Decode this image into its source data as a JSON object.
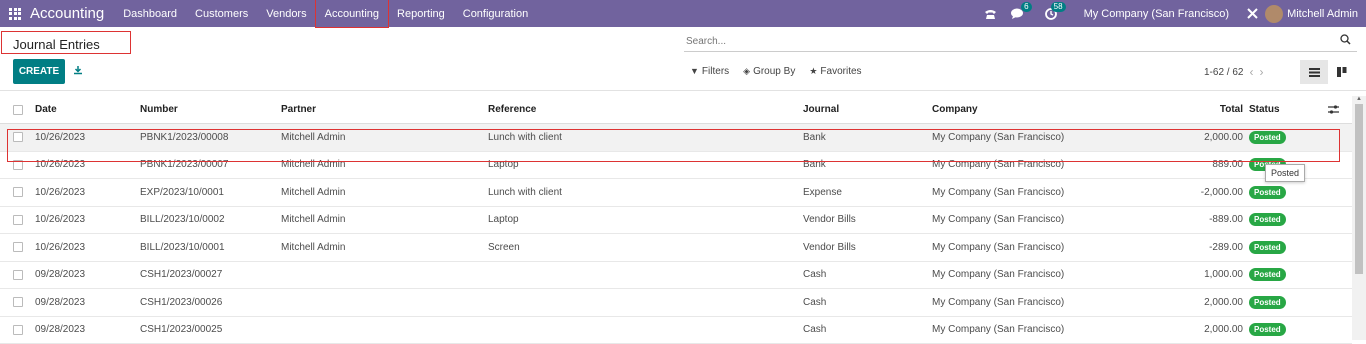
{
  "brand": "Accounting",
  "menu": [
    "Dashboard",
    "Customers",
    "Vendors",
    "Accounting",
    "Reporting",
    "Configuration"
  ],
  "systray": {
    "messages_count": "6",
    "activities_count": "58",
    "company": "My Company (San Francisco)",
    "user": "Mitchell Admin"
  },
  "page_title": "Journal Entries",
  "search": {
    "placeholder": "Search..."
  },
  "create_label": "CREATE",
  "filters": {
    "filters": "Filters",
    "group_by": "Group By",
    "favorites": "Favorites"
  },
  "pager": "1-62 / 62",
  "table": {
    "headers": {
      "date": "Date",
      "number": "Number",
      "partner": "Partner",
      "reference": "Reference",
      "journal": "Journal",
      "company": "Company",
      "total": "Total",
      "status": "Status"
    },
    "rows": [
      {
        "date": "10/26/2023",
        "number": "PBNK1/2023/00008",
        "partner": "Mitchell Admin",
        "reference": "Lunch with client",
        "journal": "Bank",
        "company": "My Company (San Francisco)",
        "total": "2,000.00",
        "status": "Posted"
      },
      {
        "date": "10/26/2023",
        "number": "PBNK1/2023/00007",
        "partner": "Mitchell Admin",
        "reference": "Laptop",
        "journal": "Bank",
        "company": "My Company (San Francisco)",
        "total": "889.00",
        "status": "Posted"
      },
      {
        "date": "10/26/2023",
        "number": "EXP/2023/10/0001",
        "partner": "Mitchell Admin",
        "reference": "Lunch with client",
        "journal": "Expense",
        "company": "My Company (San Francisco)",
        "total": "-2,000.00",
        "status": "Posted"
      },
      {
        "date": "10/26/2023",
        "number": "BILL/2023/10/0002",
        "partner": "Mitchell Admin",
        "reference": "Laptop",
        "journal": "Vendor Bills",
        "company": "My Company (San Francisco)",
        "total": "-889.00",
        "status": "Posted"
      },
      {
        "date": "10/26/2023",
        "number": "BILL/2023/10/0001",
        "partner": "Mitchell Admin",
        "reference": "Screen",
        "journal": "Vendor Bills",
        "company": "My Company (San Francisco)",
        "total": "-289.00",
        "status": "Posted"
      },
      {
        "date": "09/28/2023",
        "number": "CSH1/2023/00027",
        "partner": "",
        "reference": "",
        "journal": "Cash",
        "company": "My Company (San Francisco)",
        "total": "1,000.00",
        "status": "Posted"
      },
      {
        "date": "09/28/2023",
        "number": "CSH1/2023/00026",
        "partner": "",
        "reference": "",
        "journal": "Cash",
        "company": "My Company (San Francisco)",
        "total": "2,000.00",
        "status": "Posted"
      },
      {
        "date": "09/28/2023",
        "number": "CSH1/2023/00025",
        "partner": "",
        "reference": "",
        "journal": "Cash",
        "company": "My Company (San Francisco)",
        "total": "2,000.00",
        "status": "Posted"
      }
    ]
  },
  "tooltip": "Posted",
  "colors": {
    "topbar": "#71639e",
    "primary": "#017e84",
    "posted": "#28a745",
    "highlight": "#dd3333"
  }
}
